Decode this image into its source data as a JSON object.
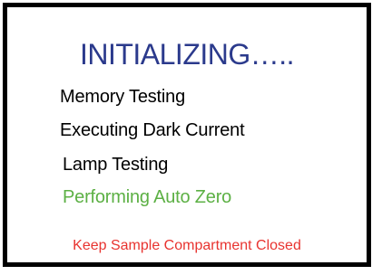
{
  "status": {
    "title": "INITIALIZING…..",
    "steps": [
      "Memory Testing",
      "Executing Dark Current",
      "Lamp Testing",
      "Performing Auto Zero"
    ],
    "warning": "Keep Sample Compartment Closed"
  },
  "colors": {
    "title": "#2b3a8c",
    "completed_step": "#000000",
    "active_step": "#5cb044",
    "warning": "#e8332f",
    "border": "#000000"
  }
}
